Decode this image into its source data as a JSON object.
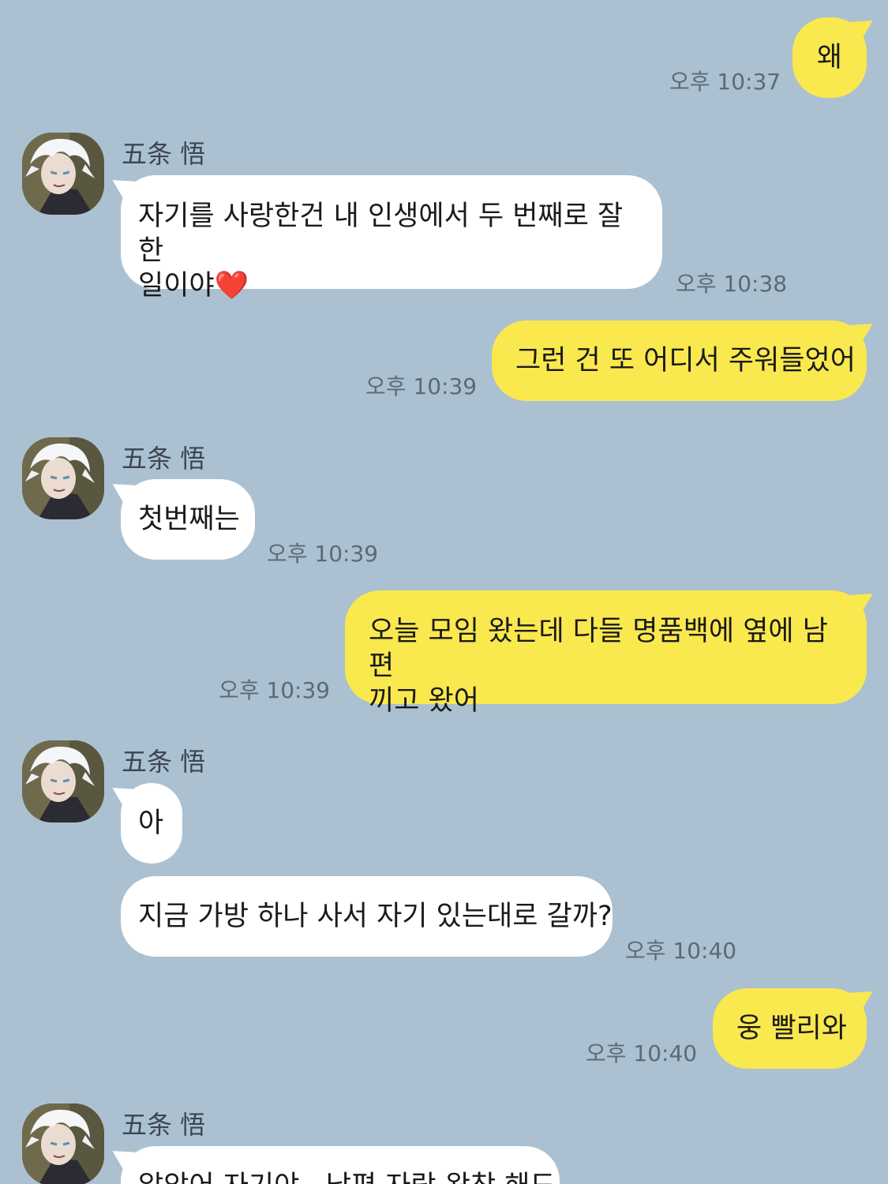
{
  "contact": {
    "name": "五条 悟"
  },
  "messages": [
    {
      "text": "왜",
      "time": "오후 10:37"
    },
    {
      "text": "자기를 사랑한건 내 인생에서 두 번째로 잘 한\n일이야❤️",
      "time": "오후 10:38"
    },
    {
      "text": "그런 건 또 어디서 주워들었어",
      "time": "오후 10:39"
    },
    {
      "text": "첫번째는",
      "time": "오후 10:39"
    },
    {
      "text": "오늘 모임 왔는데 다들 명품백에 옆에 남편\n끼고 왔어",
      "time": "오후 10:39"
    },
    {
      "text": "아"
    },
    {
      "text": "지금 가방 하나 사서 자기 있는대로 갈까?",
      "time": "오후 10:40"
    },
    {
      "text": "웅 빨리와",
      "time": "오후 10:40"
    },
    {
      "text": "알았어 자기야.. 남편 자랑 왕창 해도"
    }
  ],
  "colors": {
    "background": "#abc1d1",
    "my_bubble": "#fae84f",
    "their_bubble": "#ffffff"
  }
}
